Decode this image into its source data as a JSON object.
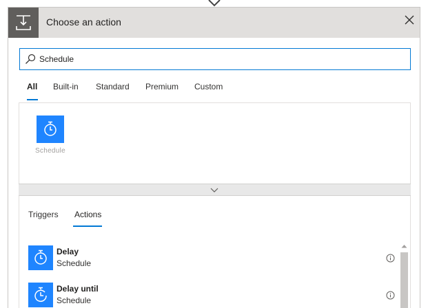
{
  "dialog": {
    "title": "Choose an action",
    "header_icon": "action-step-icon",
    "close_icon": "close-icon"
  },
  "search": {
    "value": "Schedule",
    "icon": "search-icon"
  },
  "tabs": [
    {
      "label": "All",
      "active": true
    },
    {
      "label": "Built-in",
      "active": false
    },
    {
      "label": "Standard",
      "active": false
    },
    {
      "label": "Premium",
      "active": false
    },
    {
      "label": "Custom",
      "active": false
    }
  ],
  "connectors": [
    {
      "label": "Schedule",
      "icon": "stopwatch-icon"
    }
  ],
  "expand_icon": "chevron-down-icon",
  "subtabs": [
    {
      "label": "Triggers",
      "active": false
    },
    {
      "label": "Actions",
      "active": true
    }
  ],
  "actions": [
    {
      "title": "Delay",
      "subtitle": "Schedule",
      "icon": "stopwatch-icon",
      "info_icon": "info-icon"
    },
    {
      "title": "Delay until",
      "subtitle": "Schedule",
      "icon": "stopwatch-until-icon",
      "info_icon": "info-icon"
    }
  ],
  "colors": {
    "accent": "#0078d4",
    "tile": "#1f85ff",
    "header_bg": "#e1dfdd",
    "header_icon_bg": "#605e5c"
  }
}
